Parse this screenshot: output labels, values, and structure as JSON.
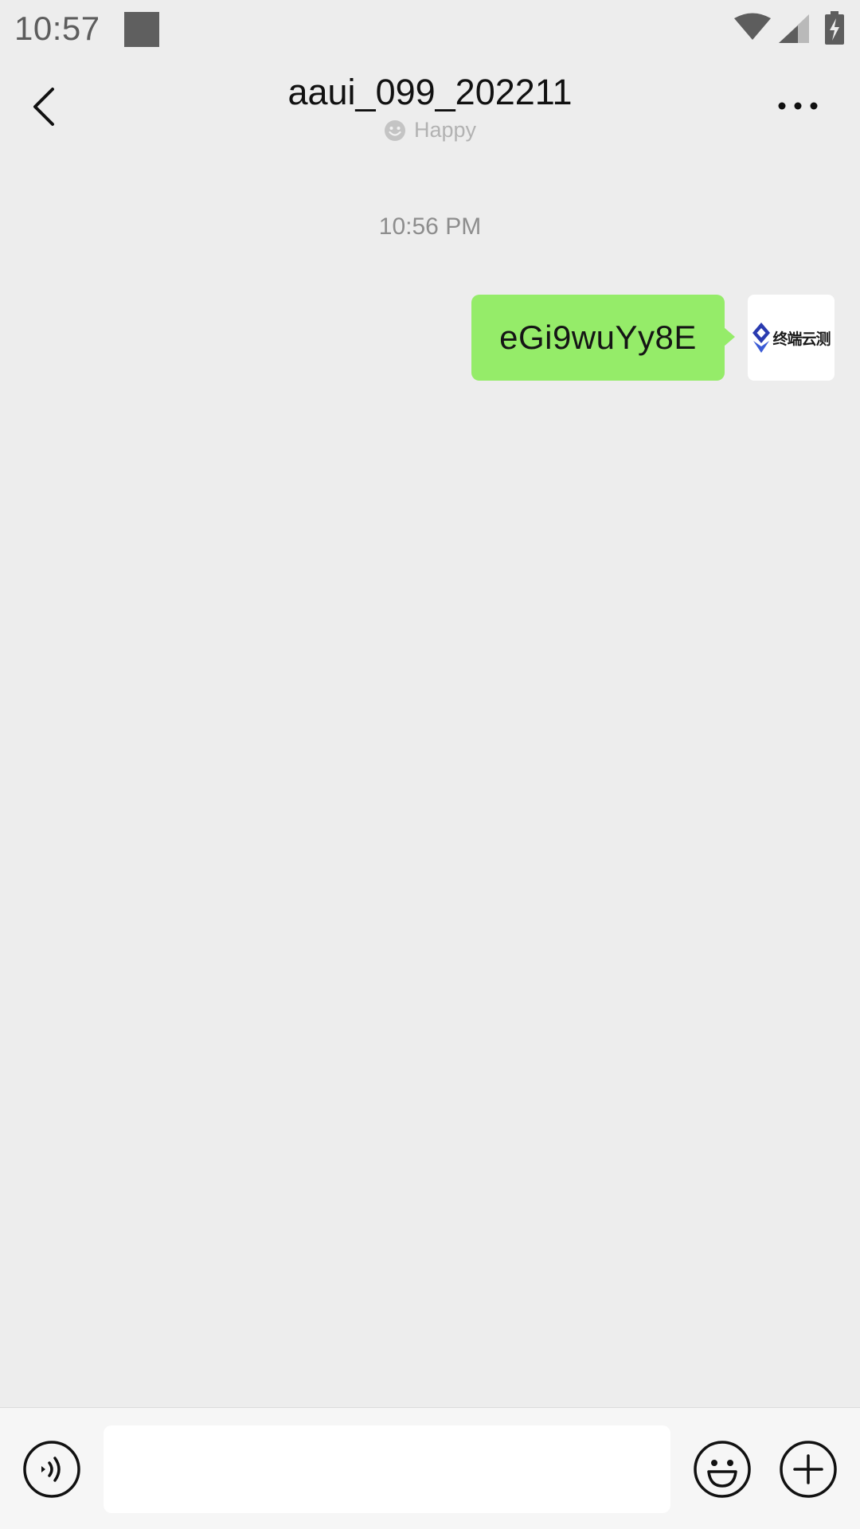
{
  "status_bar": {
    "time": "10:57"
  },
  "header": {
    "title": "aaui_099_202211",
    "status": "Happy"
  },
  "chat": {
    "timestamp": "10:56 PM",
    "messages": [
      {
        "text": "eGi9wuYy8E",
        "sender": "self",
        "avatar_text": "终端云测"
      }
    ]
  },
  "input_bar": {
    "value": "",
    "placeholder": ""
  },
  "colors": {
    "background": "#ededed",
    "bubble_self": "#95ec69",
    "input_bar": "#f6f6f6",
    "avatar_logo": "#2a3bb0"
  },
  "icons": {
    "back": "chevron-left-icon",
    "more": "more-dots-icon",
    "status_emoji": "smile-icon",
    "voice": "voice-icon",
    "emoji": "emoji-icon",
    "plus": "plus-icon"
  }
}
